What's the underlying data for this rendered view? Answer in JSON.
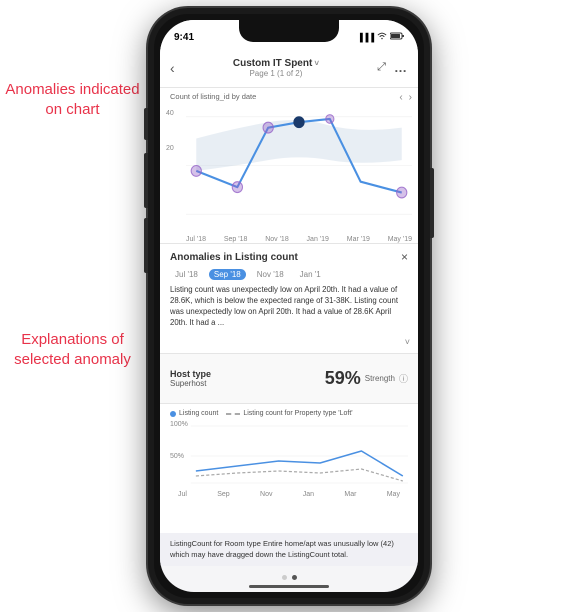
{
  "annotations": {
    "top_text": "Anomalies indicated on chart",
    "bottom_text": "Explanations of selected anomaly"
  },
  "status_bar": {
    "time": "9:41",
    "signal": "●●●",
    "wifi": "WiFi",
    "battery": "🔋"
  },
  "header": {
    "back": "‹",
    "title": "Custom IT Spent",
    "dropdown": "˅",
    "subtitle": "Page 1 (1 of 2)",
    "expand_icon": "⤢",
    "more_icon": "…"
  },
  "chart": {
    "label": "Count of listing_id by date",
    "nav_left": "‹",
    "nav_right": "›",
    "y_labels": [
      "40",
      "20"
    ],
    "x_labels": [
      "Jul '18",
      "Sep '18",
      "Nov '18",
      "Jan '19",
      "Mar '19",
      "May '19"
    ]
  },
  "anomaly_panel": {
    "title": "Anomalies in Listing count",
    "close": "×",
    "tabs": [
      {
        "label": "Jul '18",
        "active": false
      },
      {
        "label": "Sep '18",
        "active": true
      },
      {
        "label": "Nov '18",
        "active": false
      },
      {
        "label": "Jan '1",
        "active": false
      }
    ],
    "text": "Listing count was unexpectedly low on April 20th. It had a value of 28.6K, which is below the expected range of 31-38K. Listing count was unexpectedly low on April 20th. It had a value of 28.6K April 20th. It had a ...",
    "more": "˅"
  },
  "host_section": {
    "label": "Host type",
    "value": "Superhost",
    "strength_pct": "59%",
    "strength_label": "Strength",
    "info": "ⓘ"
  },
  "mini_chart": {
    "legend": [
      {
        "type": "dot",
        "color": "#4a90e2",
        "label": "Listing count"
      },
      {
        "type": "dash",
        "label": "Listing count for Property type 'Loft'"
      }
    ],
    "y_labels": [
      "100%",
      "50%"
    ],
    "x_labels": [
      "Jul",
      "Sep",
      "Nov",
      "Jan",
      "Mar",
      "May"
    ]
  },
  "explanation_box": {
    "text": "ListingCount for Room type Entire home/apt was unusually low (42) which may have dragged down the ListingCount total."
  },
  "page_dots": [
    "inactive",
    "active"
  ]
}
